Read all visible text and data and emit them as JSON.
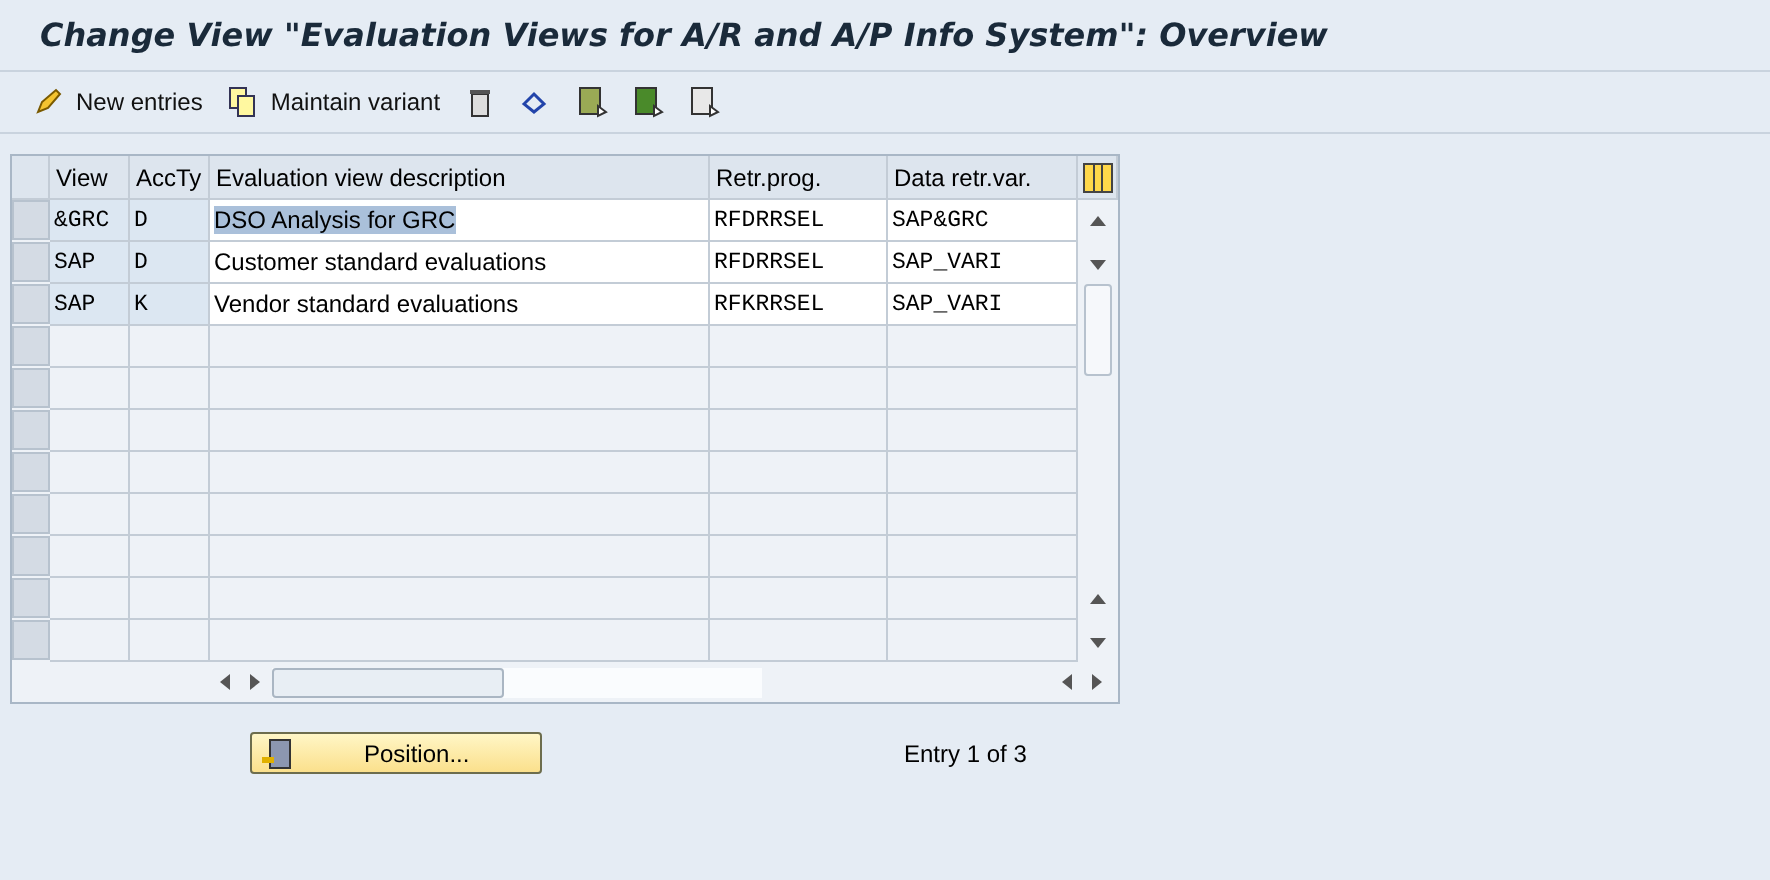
{
  "window": {
    "title": "Change View \"Evaluation Views for A/R and A/P Info System\": Overview"
  },
  "toolbar": {
    "items": [
      {
        "kind": "text",
        "label": "New entries"
      },
      {
        "kind": "text",
        "label": "Maintain variant"
      },
      {
        "kind": "icon"
      },
      {
        "kind": "icon"
      },
      {
        "kind": "icon"
      },
      {
        "kind": "icon"
      },
      {
        "kind": "icon"
      }
    ]
  },
  "table": {
    "columns": [
      "View",
      "AccTy",
      "Evaluation view description",
      "Retr.prog.",
      "Data retr.var."
    ],
    "rows": [
      {
        "cells": [
          "&GRC",
          "D",
          "DSO Analysis for GRC",
          "RFDRRSEL",
          "SAP&GRC"
        ],
        "highlighted": true
      },
      {
        "cells": [
          "SAP",
          "D",
          "Customer standard evaluations",
          "RFDRRSEL",
          "SAP_VARI"
        ],
        "highlighted": false
      },
      {
        "cells": [
          "SAP",
          "K",
          "Vendor standard evaluations",
          "RFKRRSEL",
          "SAP_VARI"
        ],
        "highlighted": false
      }
    ]
  },
  "position_button": {
    "label": "Position..."
  },
  "entry_info": "Entry 1 of 3"
}
